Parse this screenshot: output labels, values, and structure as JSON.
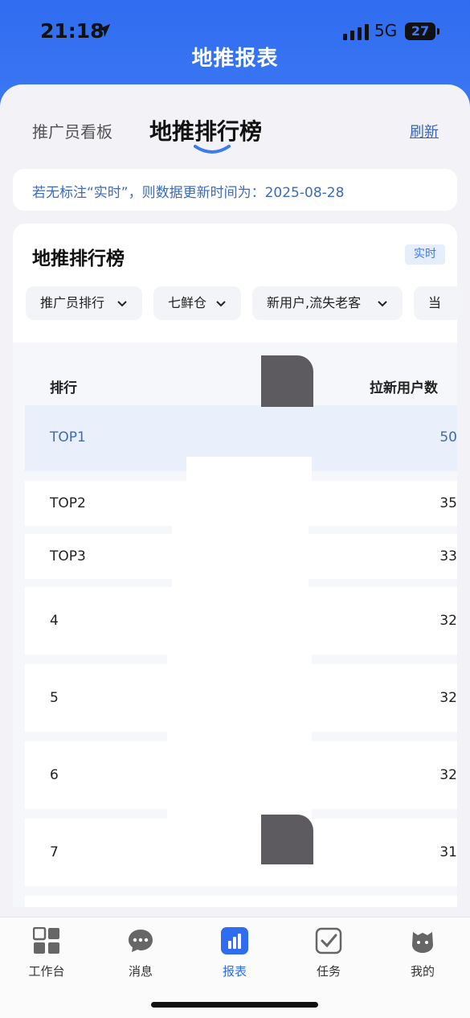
{
  "status_bar": {
    "time": "21:18",
    "network": "5G",
    "battery": "27"
  },
  "header": {
    "title": "地推报表"
  },
  "tabs": {
    "kanban": "推广员看板",
    "ranking": "地推排行榜",
    "refresh": "刷新"
  },
  "notice": "若无标注“实时”，则数据更新时间为：2025-08-28",
  "panel": {
    "title": "地推排行榜",
    "badge": "实时",
    "filters": [
      "推广员排行",
      "七鲜仓",
      "新用户,流失老客",
      "当"
    ],
    "columns": {
      "rank": "排行",
      "value": "拉新用户数"
    },
    "rows": [
      {
        "rank": "TOP1",
        "value": "50"
      },
      {
        "rank": "TOP2",
        "value": "35"
      },
      {
        "rank": "TOP3",
        "value": "33"
      },
      {
        "rank": "4",
        "value": "32"
      },
      {
        "rank": "5",
        "value": "32"
      },
      {
        "rank": "6",
        "value": "32"
      },
      {
        "rank": "7",
        "value": "31"
      }
    ]
  },
  "tabbar": {
    "items": [
      "工作台",
      "消息",
      "报表",
      "任务",
      "我的"
    ],
    "active": "报表"
  },
  "colors": {
    "brand": "#2f6cf0",
    "accent_text": "#3a6bc2"
  }
}
